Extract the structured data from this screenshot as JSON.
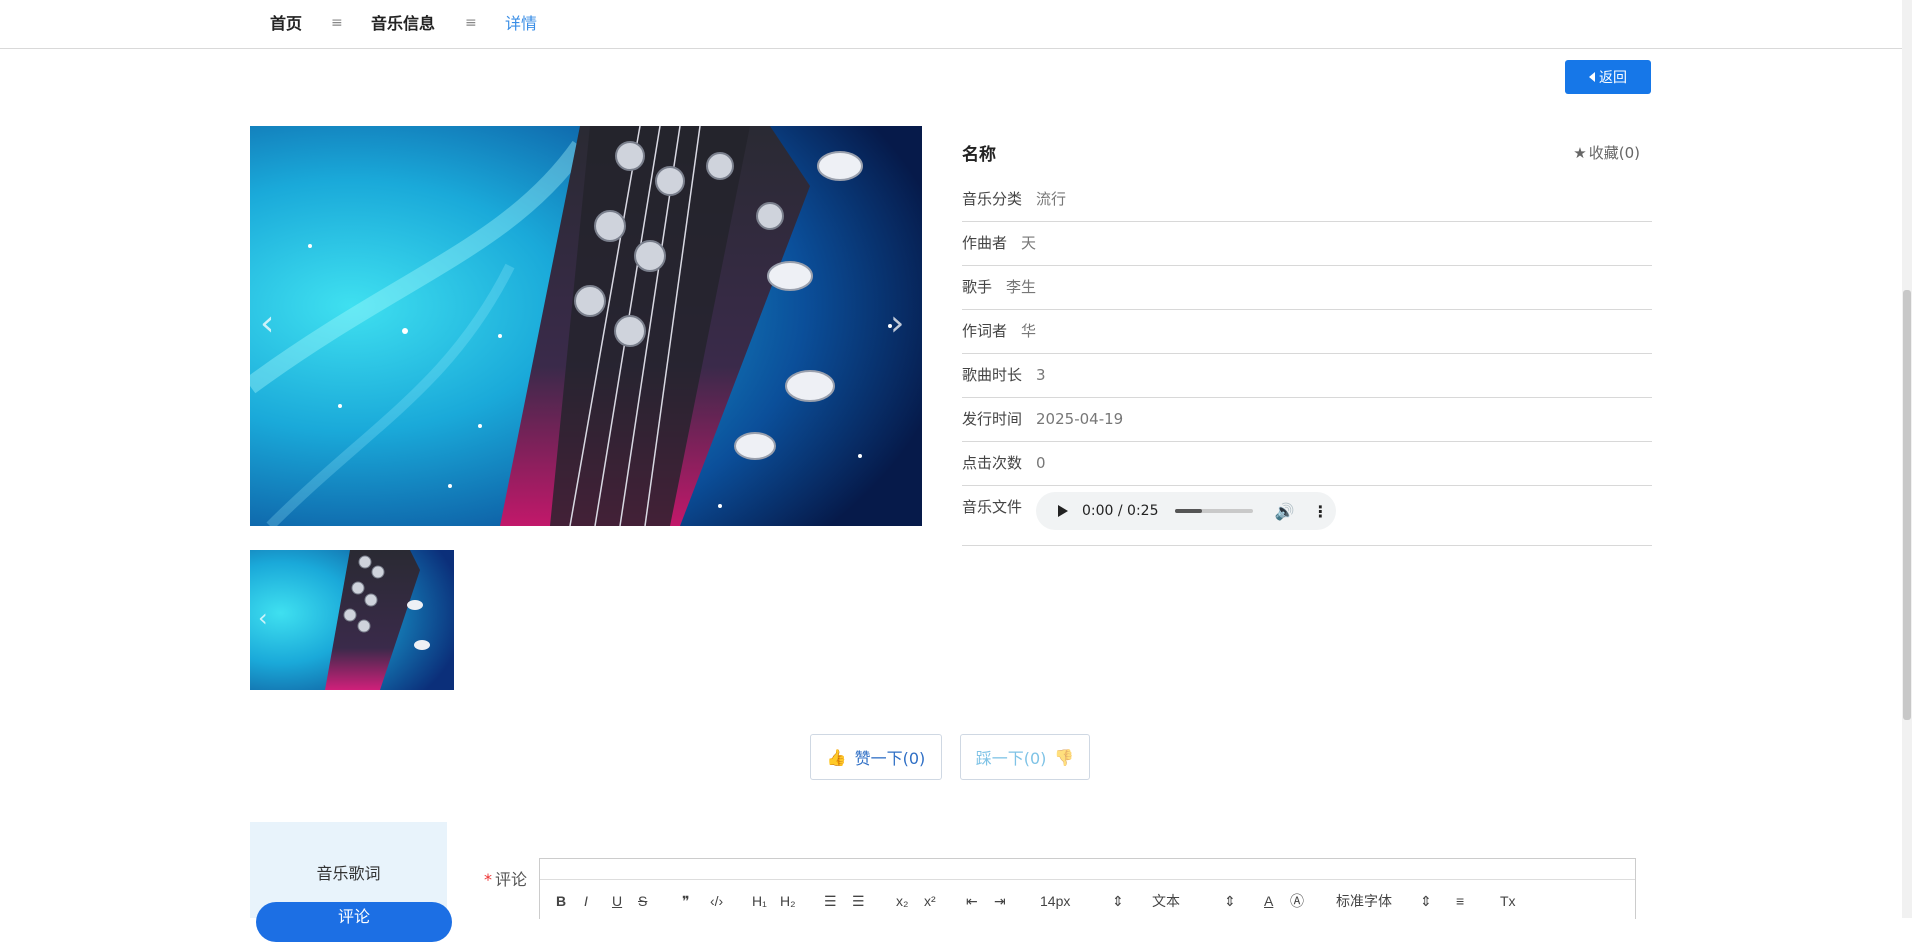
{
  "breadcrumb": {
    "home": "首页",
    "music": "音乐信息",
    "detail": "详情",
    "separator": "≡"
  },
  "back_button": {
    "label": "返回"
  },
  "detail": {
    "title": "名称",
    "favorite": "收藏(0)",
    "fields": [
      {
        "label": "音乐分类",
        "value": "流行"
      },
      {
        "label": "作曲者",
        "value": "天"
      },
      {
        "label": "歌手",
        "value": "李生"
      },
      {
        "label": "作词者",
        "value": "华"
      },
      {
        "label": "歌曲时长",
        "value": "3"
      },
      {
        "label": "发行时间",
        "value": "2025-04-19"
      },
      {
        "label": "点击次数",
        "value": "0"
      }
    ],
    "audio_label": "音乐文件",
    "audio": {
      "time": "0:00 / 0:25",
      "progress": 0.35
    }
  },
  "carousel": {
    "prev_icon": "chevron-left-icon",
    "next_icon": "chevron-right-icon"
  },
  "votes": {
    "like": "赞一下(0)",
    "dislike": "踩一下(0)"
  },
  "tabs": {
    "lyrics": "音乐歌词",
    "comment": "评论"
  },
  "comment": {
    "label": "评论",
    "toolbar": {
      "size": "14px",
      "heading": "文本",
      "font": "标准字体"
    }
  },
  "colors": {
    "primary": "#1677e8",
    "link": "#3a8ee6",
    "tab_bg": "#e8f3fb"
  }
}
